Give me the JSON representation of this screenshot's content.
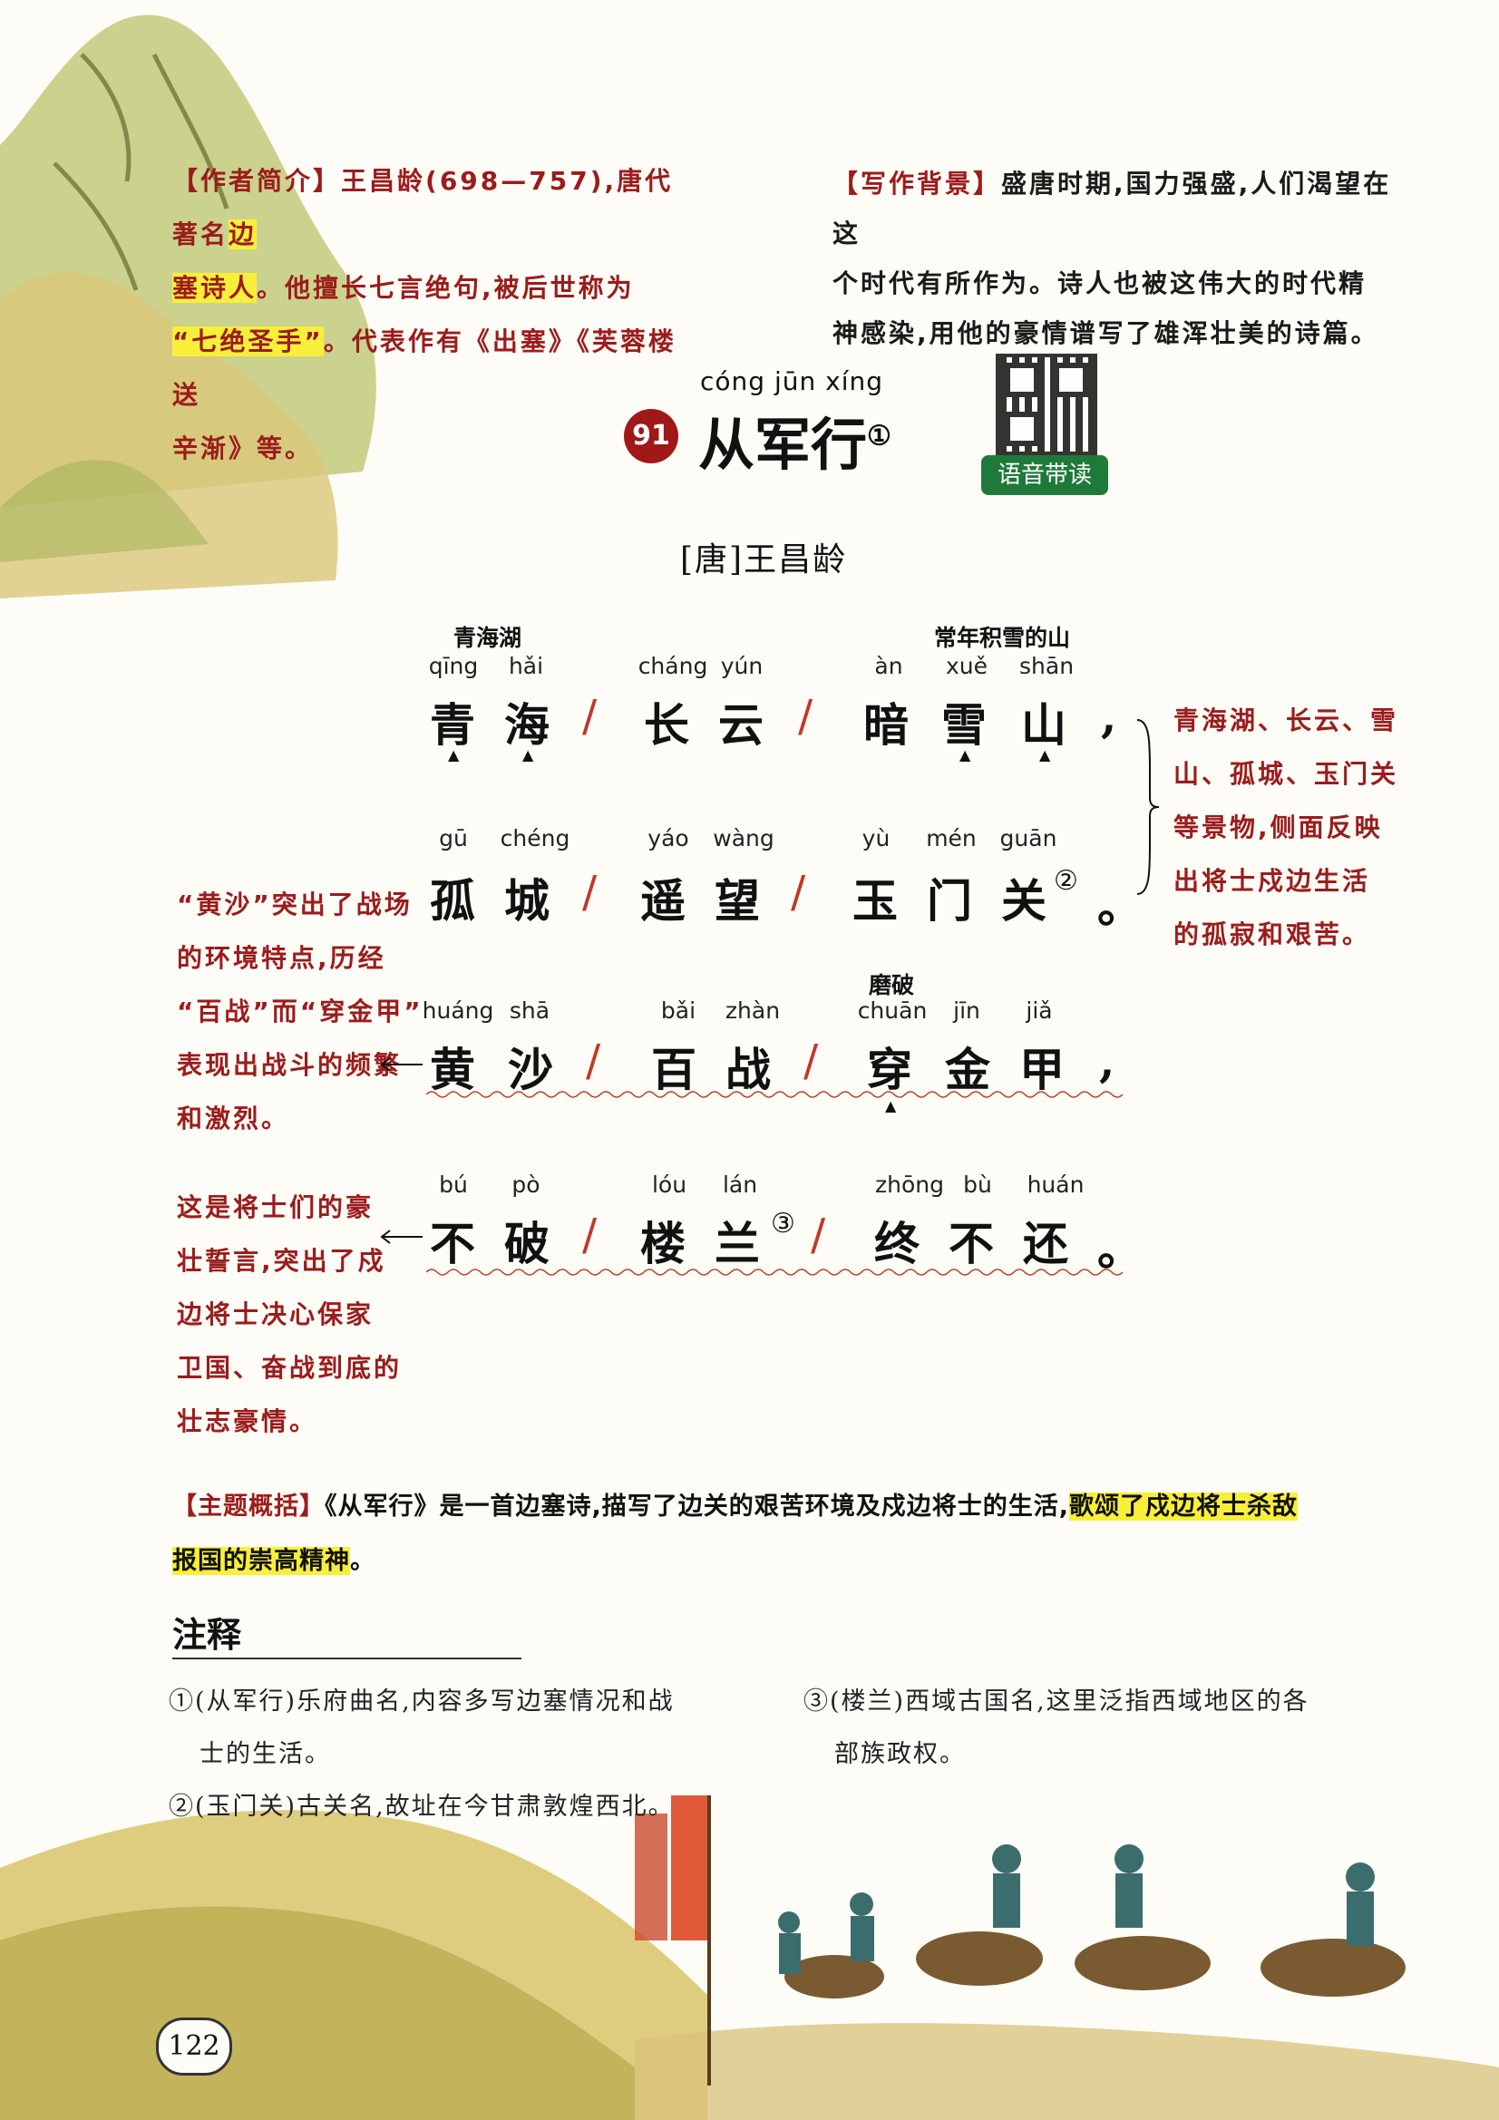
{
  "author_intro": {
    "label": "【作者简介】",
    "line1_rest": "王昌龄(698—757),唐代著名",
    "hl1": "边",
    "hl2": "塞诗人",
    "line2_rest": "。他擅长七言绝句,被后世称为",
    "hl3": "“七绝圣手”",
    "line3_rest": "。代表作有《出塞》《芙蓉楼送",
    "line4": "辛渐》等。"
  },
  "background": {
    "label": "【写作背景】",
    "line1_rest": "盛唐时期,国力强盛,人们渴望在这",
    "line2": "个时代有所作为。诗人也被这伟大的时代精",
    "line3": "神感染,用他的豪情谱写了雄浑壮美的诗篇。"
  },
  "title": {
    "number": "91",
    "pinyin": "cóng jūn xíng",
    "text": "从军行",
    "note_mark": "①",
    "qr_label": "语音带读"
  },
  "author_line": "[唐]王昌龄",
  "poem": {
    "line1": {
      "annot_left": "青海湖",
      "annot_right": "常年积雪的山",
      "pinyin": [
        "qīng",
        "hǎi",
        "cháng",
        "yún",
        "àn",
        "xuě",
        "shān"
      ],
      "chars": [
        "青",
        "海",
        "长",
        "云",
        "暗",
        "雪",
        "山"
      ],
      "punct": ","
    },
    "line2": {
      "pinyin": [
        "gū",
        "chéng",
        "yáo",
        "wàng",
        "yù",
        "mén",
        "guān"
      ],
      "chars": [
        "孤",
        "城",
        "遥",
        "望",
        "玉",
        "门",
        "关"
      ],
      "mark": "②",
      "punct": "。"
    },
    "line3": {
      "annot_right": "磨破",
      "pinyin": [
        "huáng",
        "shā",
        "bǎi",
        "zhàn",
        "chuān",
        "jīn",
        "jiǎ"
      ],
      "chars": [
        "黄",
        "沙",
        "百",
        "战",
        "穿",
        "金",
        "甲"
      ],
      "punct": ","
    },
    "line4": {
      "pinyin": [
        "bú",
        "pò",
        "lóu",
        "lán",
        "zhōng",
        "bù",
        "huán"
      ],
      "chars": [
        "不",
        "破",
        "楼",
        "兰",
        "终",
        "不",
        "还"
      ],
      "mark": "③",
      "punct": "。"
    },
    "slash": "/"
  },
  "side_notes": {
    "right": [
      "青海湖、长云、雪",
      "山、孤城、玉门关",
      "等景物,侧面反映",
      "出将士戍边生活",
      "的孤寂和艰苦。"
    ],
    "left1": [
      "“黄沙”突出了战场",
      "的环境特点,历经",
      "“百战”而“穿金甲”",
      "表现出战斗的频繁",
      "和激烈。"
    ],
    "left2": [
      "这是将士们的豪",
      "壮誓言,突出了戍",
      "边将士决心保家",
      "卫国、奋战到底的",
      "壮志豪情。"
    ]
  },
  "theme": {
    "label": "【主题概括】",
    "text1": "《从军行》是一首边塞诗,描写了边关的艰苦环境及戍边将士的生活,",
    "hl_a": "歌颂了戍边将士杀敌",
    "hl_b": "报国的崇高精神",
    "end": "。"
  },
  "notes": {
    "heading": "注释",
    "n1a": "①(从军行)乐府曲名,内容多写边塞情况和战",
    "n1b": "士的生活。",
    "n2": "②(玉门关)古关名,故址在今甘肃敦煌西北。",
    "n3a": "③(楼兰)西域古国名,这里泛指西域地区的各",
    "n3b": "部族政权。"
  },
  "page_number": "122",
  "colors": {
    "accent_red": "#9b1c1c",
    "highlight": "#f8ef3a",
    "number_badge": "#a01818",
    "qr_badge": "#1f7a3a"
  }
}
